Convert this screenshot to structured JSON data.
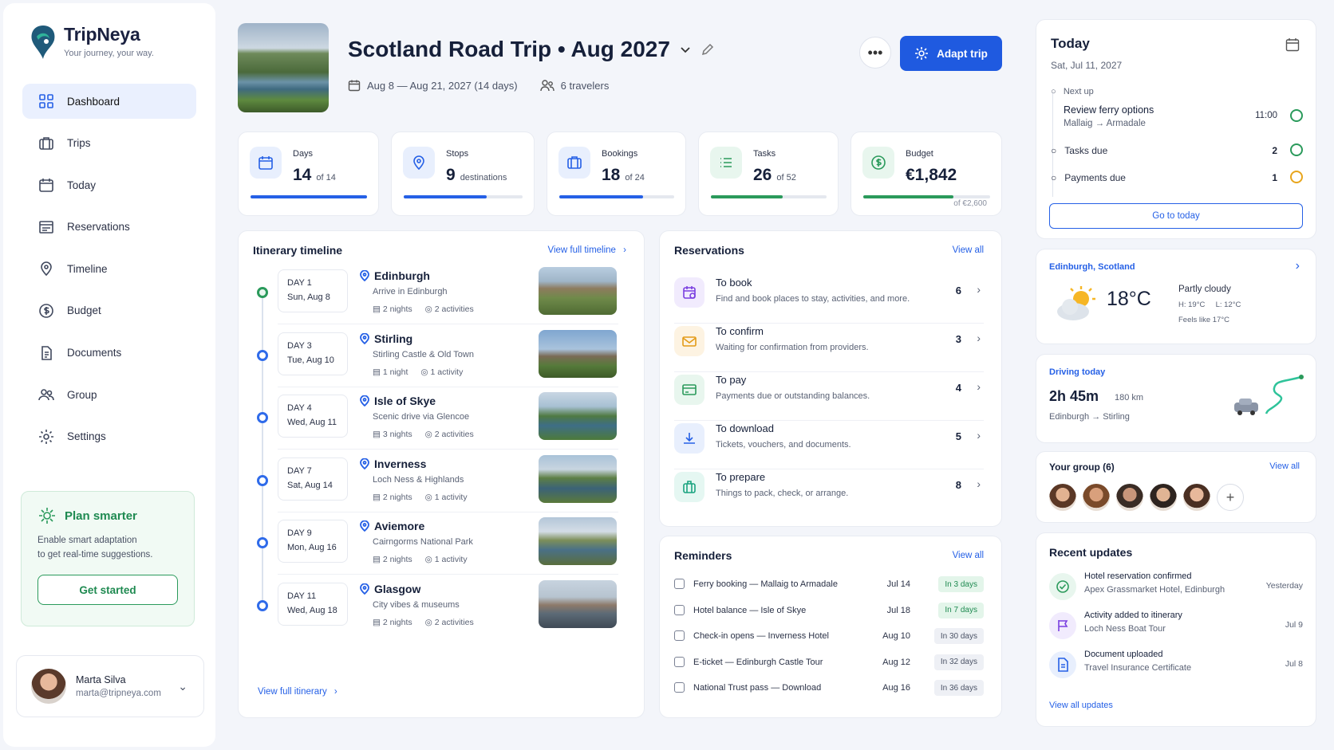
{
  "brand": {
    "name": "TripNeya",
    "tagline": "Your journey, your way."
  },
  "nav": [
    {
      "label": "Dashboard",
      "icon": "dashboard-icon",
      "active": true
    },
    {
      "label": "Trips",
      "icon": "suitcase-icon"
    },
    {
      "label": "Today",
      "icon": "calendar-icon"
    },
    {
      "label": "Reservations",
      "icon": "reservations-icon"
    },
    {
      "label": "Timeline",
      "icon": "map-pin-icon"
    },
    {
      "label": "Budget",
      "icon": "dollar-icon"
    },
    {
      "label": "Documents",
      "icon": "document-icon"
    },
    {
      "label": "Group",
      "icon": "group-icon"
    },
    {
      "label": "Settings",
      "icon": "gear-icon"
    }
  ],
  "promo": {
    "title": "Plan smarter",
    "desc1": "Enable smart adaptation",
    "desc2": "to get real-time suggestions.",
    "button": "Get started"
  },
  "user": {
    "name": "Marta Silva",
    "email": "marta@tripneya.com"
  },
  "trip": {
    "title": "Scotland Road Trip • Aug 2027",
    "dates": "Aug 8 — Aug 21, 2027 (14 days)",
    "travelers": "6 travelers"
  },
  "actions": {
    "adapt": "Adapt trip"
  },
  "stats": [
    {
      "label": "Days",
      "value": "14",
      "of": "of 14",
      "progress": 1.0,
      "color": "#2560e6"
    },
    {
      "label": "Stops",
      "value": "9",
      "of": "destinations",
      "progress": 0.7,
      "color": "#2560e6"
    },
    {
      "label": "Bookings",
      "value": "18",
      "of": "of 24",
      "progress": 0.73,
      "color": "#2560e6"
    },
    {
      "label": "Tasks",
      "value": "26",
      "of": "of 52",
      "progress": 0.62,
      "color": "#2a9a5b"
    },
    {
      "label": "Budget",
      "value": "€1,842",
      "of": "",
      "sub": "of €2,600",
      "progress": 0.71,
      "color": "#2a9a5b"
    }
  ],
  "timeline": {
    "title": "Itinerary timeline",
    "link": "View full timeline",
    "footer": "View full itinerary",
    "items": [
      {
        "day": "DAY 1",
        "date": "Sun, Aug 8",
        "place": "Edinburgh",
        "desc": "Arrive in Edinburgh",
        "nights": "2 nights",
        "acts": "2 activities",
        "done": true
      },
      {
        "day": "DAY 3",
        "date": "Tue, Aug 10",
        "place": "Stirling",
        "desc": "Stirling Castle & Old Town",
        "nights": "1 night",
        "acts": "1 activity"
      },
      {
        "day": "DAY 4",
        "date": "Wed, Aug 11",
        "place": "Isle of Skye",
        "desc": "Scenic drive via Glencoe",
        "nights": "3 nights",
        "acts": "2 activities"
      },
      {
        "day": "DAY 7",
        "date": "Sat, Aug 14",
        "place": "Inverness",
        "desc": "Loch Ness & Highlands",
        "nights": "2 nights",
        "acts": "1 activity"
      },
      {
        "day": "DAY 9",
        "date": "Mon, Aug 16",
        "place": "Aviemore",
        "desc": "Cairngorms National Park",
        "nights": "2 nights",
        "acts": "1 activity"
      },
      {
        "day": "DAY 11",
        "date": "Wed, Aug 18",
        "place": "Glasgow",
        "desc": "City vibes & museums",
        "nights": "2 nights",
        "acts": "2 activities"
      }
    ]
  },
  "reservations": {
    "title": "Reservations",
    "link": "View all",
    "items": [
      {
        "name": "To book",
        "desc": "Find and book places to stay, activities, and more.",
        "count": "6",
        "icon": "calendar-plus-icon",
        "bg": "#f1ebfd",
        "fg": "#7a3fe0"
      },
      {
        "name": "To confirm",
        "desc": "Waiting for confirmation from providers.",
        "count": "3",
        "icon": "envelope-icon",
        "bg": "#fdf3e2",
        "fg": "#e39a16"
      },
      {
        "name": "To pay",
        "desc": "Payments due or outstanding balances.",
        "count": "4",
        "icon": "credit-card-icon",
        "bg": "#e8f6ee",
        "fg": "#2a9a5b"
      },
      {
        "name": "To download",
        "desc": "Tickets, vouchers, and documents.",
        "count": "5",
        "icon": "download-icon",
        "bg": "#e8effd",
        "fg": "#2560e6"
      },
      {
        "name": "To prepare",
        "desc": "Things to pack, check, or arrange.",
        "count": "8",
        "icon": "luggage-icon",
        "bg": "#e5f7f2",
        "fg": "#1aa37f"
      }
    ]
  },
  "reminders": {
    "title": "Reminders",
    "link": "View all",
    "items": [
      {
        "text": "Ferry booking — Mallaig to Armadale",
        "date": "Jul 14",
        "badge": "In 3 days",
        "urgent": true
      },
      {
        "text": "Hotel balance — Isle of Skye",
        "date": "Jul 18",
        "badge": "In 7 days",
        "urgent": true
      },
      {
        "text": "Check-in opens — Inverness Hotel",
        "date": "Aug 10",
        "badge": "In 30 days"
      },
      {
        "text": "E-ticket — Edinburgh Castle Tour",
        "date": "Aug 12",
        "badge": "In 32 days"
      },
      {
        "text": "National Trust pass — Download",
        "date": "Aug 16",
        "badge": "In 36 days"
      }
    ]
  },
  "today": {
    "title": "Today",
    "date": "Sat, Jul 11, 2027",
    "next_label": "Next up",
    "next_title": "Review ferry options",
    "next_route": "Mallaig → Armadale",
    "next_time": "11:00",
    "tasks_label": "Tasks due",
    "tasks_count": "2",
    "payments_label": "Payments due",
    "payments_count": "1",
    "button": "Go to today"
  },
  "weather": {
    "location": "Edinburgh, Scotland",
    "temp": "18°C",
    "cond": "Partly cloudy",
    "hl": "H: 19°C     L: 12°C",
    "feels": "Feels like 17°C"
  },
  "driving": {
    "label": "Driving today",
    "time": "2h 45m",
    "dist": "180 km",
    "route": "Edinburgh → Stirling"
  },
  "group": {
    "title": "Your group (6)",
    "link": "View all"
  },
  "updates": {
    "title": "Recent updates",
    "link": "View all updates",
    "items": [
      {
        "t": "Hotel reservation confirmed",
        "s": "Apex Grassmarket Hotel, Edinburgh",
        "d": "Yesterday",
        "icon": "check-circle-icon",
        "bg": "#e8f6ee",
        "fg": "#2a9a5b"
      },
      {
        "t": "Activity added to itinerary",
        "s": "Loch Ness Boat Tour",
        "d": "Jul 9",
        "icon": "flag-icon",
        "bg": "#f1ebfd",
        "fg": "#7a3fe0"
      },
      {
        "t": "Document uploaded",
        "s": "Travel Insurance Certificate",
        "d": "Jul 8",
        "icon": "file-icon",
        "bg": "#e8effd",
        "fg": "#2560e6"
      }
    ]
  }
}
